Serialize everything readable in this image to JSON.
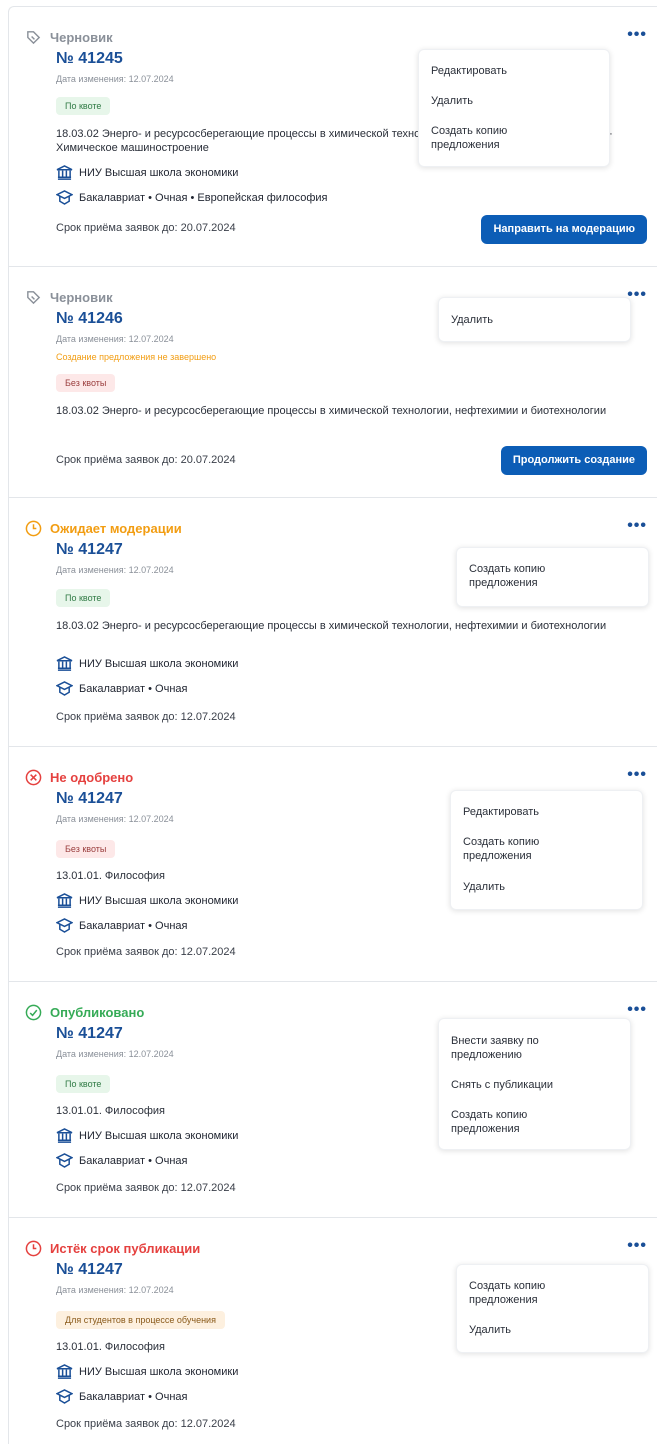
{
  "icons": {
    "draft": "pencil-tag-icon",
    "waiting": "clock-icon",
    "rejected": "x-circle-icon",
    "published": "check-circle-icon",
    "expired": "clock-icon",
    "university": "building-icon",
    "education": "graduation-cap-icon",
    "menu": "more-horizontal-icon"
  },
  "colors": {
    "primary": "#0c5db6",
    "number": "#1a4f97",
    "draft": "#8a9099",
    "waiting": "#f29d12",
    "rejected": "#e5413f",
    "published": "#36ab57"
  },
  "cards": [
    {
      "status": "Черновик",
      "number": "№ 41245",
      "date": "Дата изменения: 12.07.2024",
      "chip": "По квоте",
      "spec": "18.03.02 Энерго- и ресурсосберегающие процессы в химической технологии, нефтехимии и биотехнологии · Химическое машиностроение",
      "university": "НИУ Высшая школа экономики",
      "education": "Бакалавриат  •  Очная  •  Европейская философия",
      "deadline": "Срок приёма заявок до: 20.07.2024",
      "button": "Направить на модерацию",
      "menu": [
        "Редактировать",
        "Удалить",
        "Создать копию предложения"
      ]
    },
    {
      "status": "Черновик",
      "number": "№ 41246",
      "date": "Дата изменения: 12.07.2024",
      "warning": "Создание предложения не завершено",
      "chip": "Без квоты",
      "spec": "18.03.02 Энерго- и ресурсосберегающие процессы в химической технологии, нефтехимии и биотехнологии",
      "deadline": "Срок приёма заявок до: 20.07.2024",
      "button": "Продолжить создание",
      "menu": [
        "Удалить"
      ]
    },
    {
      "status": "Ожидает модерации",
      "number": "№ 41247",
      "date": "Дата изменения: 12.07.2024",
      "chip": "По квоте",
      "spec": "18.03.02 Энерго- и ресурсосберегающие процессы в химической технологии, нефтехимии и биотехнологии",
      "university": "НИУ Высшая школа экономики",
      "education": "Бакалавриат  •  Очная",
      "deadline": "Срок приёма заявок до: 12.07.2024",
      "menu": [
        "Создать копию предложения"
      ]
    },
    {
      "status": "Не одобрено",
      "number": "№ 41247",
      "date": "Дата изменения: 12.07.2024",
      "chip": "Без квоты",
      "spec": "13.01.01. Философия",
      "university": "НИУ Высшая школа экономики",
      "education": "Бакалавриат  •  Очная",
      "deadline": "Срок приёма заявок до: 12.07.2024",
      "menu": [
        "Редактировать",
        "Создать копию предложения",
        "Удалить"
      ]
    },
    {
      "status": "Опубликовано",
      "number": "№ 41247",
      "date": "Дата изменения: 12.07.2024",
      "chip": "По квоте",
      "spec": "13.01.01. Философия",
      "university": "НИУ Высшая школа экономики",
      "education": "Бакалавриат  •  Очная",
      "deadline": "Срок приёма заявок до: 12.07.2024",
      "menu": [
        "Внести заявку по предложению",
        "Снять с публикации",
        "Создать копию предложения"
      ]
    },
    {
      "status": "Истёк срок публикации",
      "number": "№ 41247",
      "date": "Дата изменения: 12.07.2024",
      "chip": "Для студентов в процессе обучения",
      "spec": "13.01.01. Философия",
      "university": "НИУ Высшая школа экономики",
      "education": "Бакалавриат  •  Очная",
      "deadline": "Срок приёма заявок до: 12.07.2024",
      "menu": [
        "Создать копию предложения",
        "Удалить"
      ]
    }
  ]
}
